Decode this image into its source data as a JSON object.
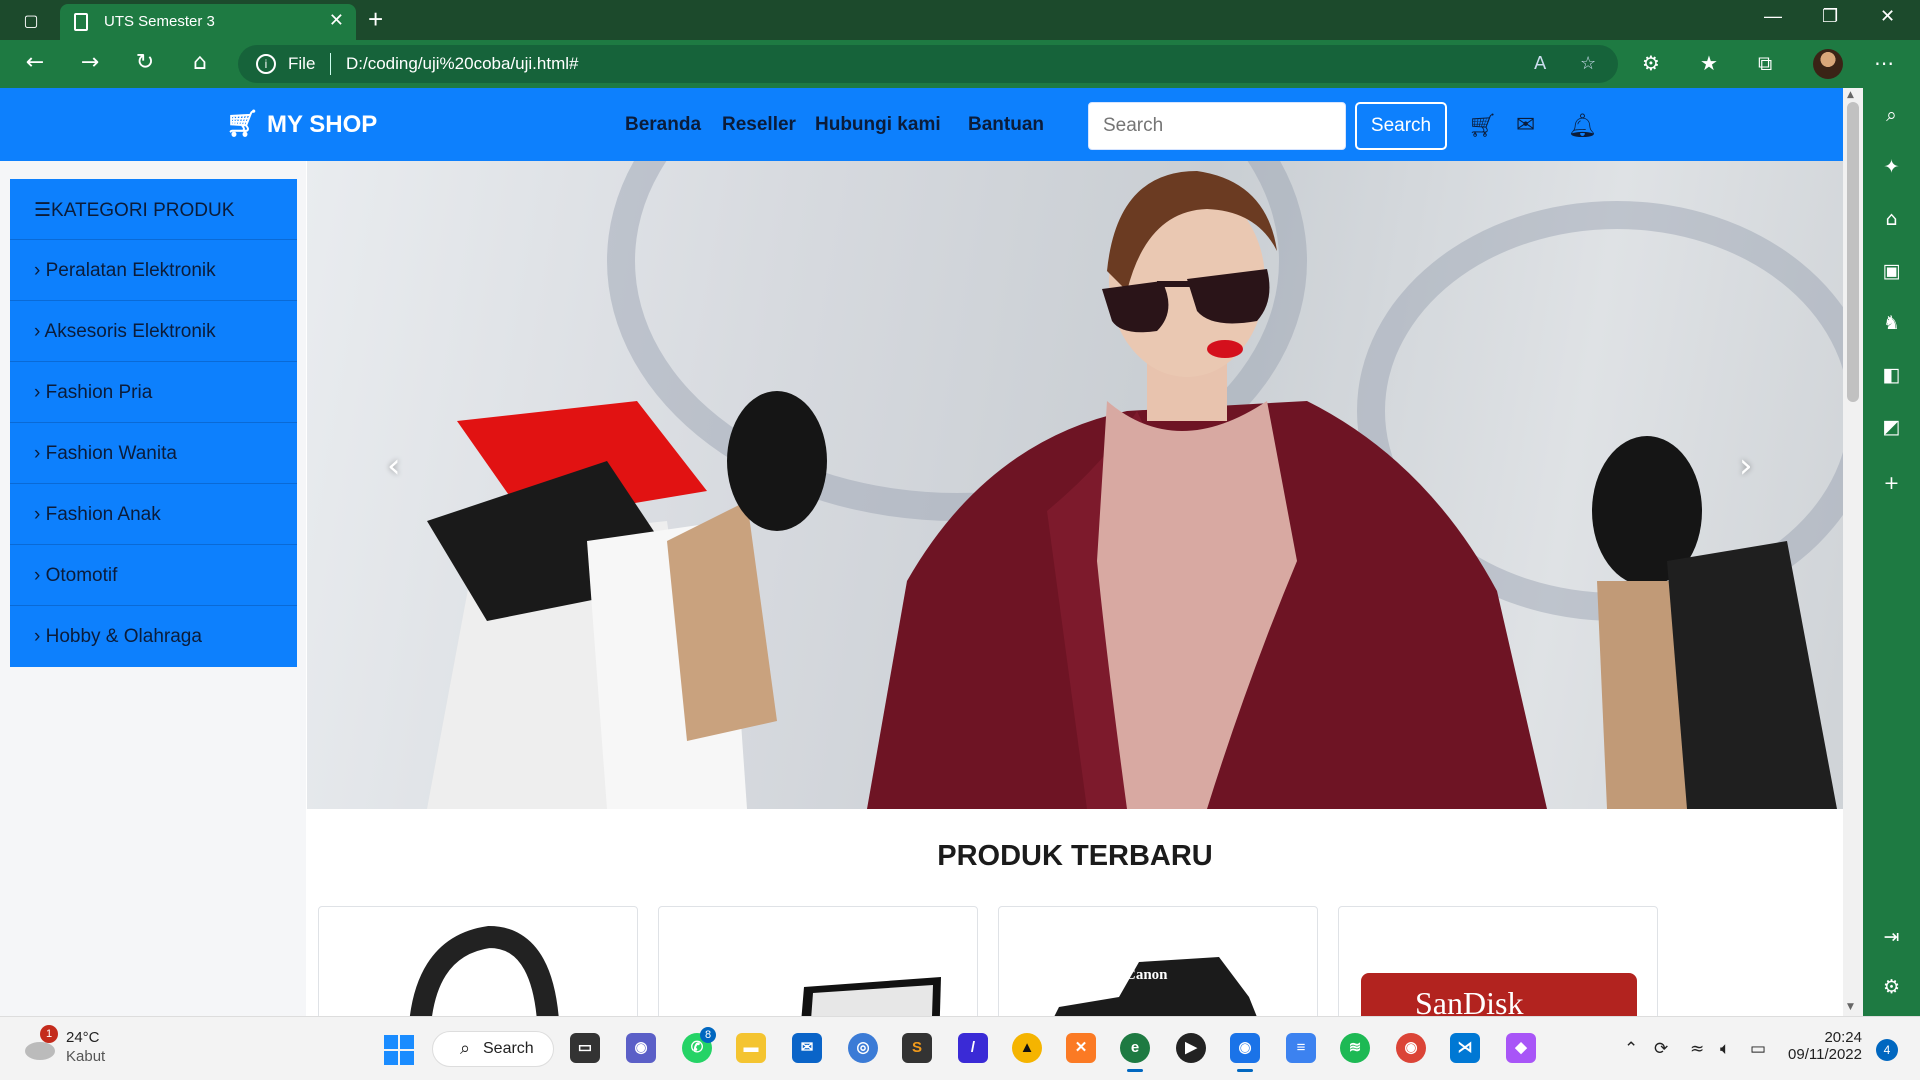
{
  "browser": {
    "tab_title": "UTS Semester 3",
    "address_scheme": "File",
    "address_url": "D:/coding/uji%20coba/uji.html#"
  },
  "shop": {
    "brand": "MY SHOP",
    "menu": [
      "Beranda",
      "Reseller",
      "Hubungi kami",
      "Bantuan"
    ],
    "search_placeholder": "Search",
    "search_button": "Search",
    "category_header": "KATEGORI PRODUK",
    "categories": [
      "› Peralatan Elektronik",
      "› Aksesoris Elektronik",
      "› Fashion Pria",
      "› Fashion Wanita",
      "› Fashion Anak",
      "› Otomotif",
      "› Hobby & Olahraga"
    ],
    "section_title": "PRODUK TERBARU",
    "product_brand_text_1": "Canon",
    "product_brand_text_2": "SanDisk"
  },
  "taskbar": {
    "weather_temp": "24°C",
    "weather_cond": "Kabut",
    "weather_badge": "1",
    "search_label": "Search",
    "whatsapp_badge": "8",
    "time": "20:24",
    "date": "09/11/2022",
    "notification_count": "4"
  },
  "colors": {
    "browser_green": "#1e7a42",
    "shop_blue": "#0d80fd",
    "text_dark": "#0b1c3a"
  }
}
